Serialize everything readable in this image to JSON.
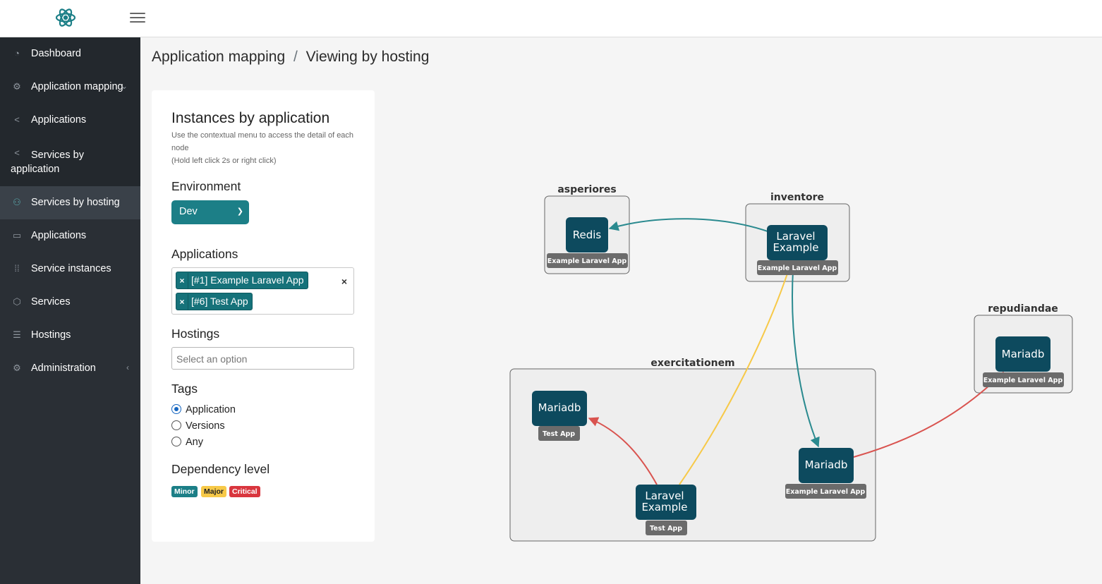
{
  "sidebar": {
    "items": [
      {
        "label": "Dashboard",
        "icon": "speedometer-icon"
      },
      {
        "label": "Application mapping",
        "icon": "gear-icon",
        "caret": "⌄"
      },
      {
        "label": "Applications",
        "icon": "share-icon"
      },
      {
        "label": "Services by",
        "label2": "application",
        "icon": "share-icon"
      },
      {
        "label": "Services by hosting",
        "icon": "hosting-tree-icon"
      },
      {
        "label": "Applications",
        "icon": "window-icon"
      },
      {
        "label": "Service instances",
        "icon": "grid-dots-icon"
      },
      {
        "label": "Services",
        "icon": "box-icon"
      },
      {
        "label": "Hostings",
        "icon": "list-icon"
      },
      {
        "label": "Administration",
        "icon": "gear-icon",
        "caret": "‹"
      }
    ]
  },
  "breadcrumb": {
    "parent": "Application mapping",
    "separator": "/",
    "current": "Viewing by hosting"
  },
  "panel": {
    "title": "Instances by application",
    "hint_line1": "Use the contextual menu to access the detail of each node",
    "hint_line2": "(Hold left click 2s or right click)",
    "environment_label": "Environment",
    "environment_value": "Dev",
    "applications_label": "Applications",
    "applications_selected": [
      "[#1] Example Laravel App",
      "[#6] Test App"
    ],
    "chip_remove": "×",
    "clear_all": "×",
    "hostings_label": "Hostings",
    "hostings_placeholder": "Select an option",
    "tags_label": "Tags",
    "tags_options": [
      "Application",
      "Versions",
      "Any"
    ],
    "tags_selected": "Application",
    "dependency_label": "Dependency level",
    "dependency_levels": [
      {
        "label": "Minor",
        "color": "#1c7f87"
      },
      {
        "label": "Major",
        "color": "#f7c948"
      },
      {
        "label": "Critical",
        "color": "#d9363e"
      }
    ]
  },
  "graph": {
    "hostings": [
      "asperiores",
      "inventore",
      "repudiandae",
      "exercitationem"
    ],
    "nodes": [
      {
        "label": "Redis",
        "tag": "Example Laravel App",
        "host": "asperiores"
      },
      {
        "label": "Laravel Example",
        "tag": "Example Laravel App",
        "host": "inventore"
      },
      {
        "label": "Mariadb",
        "tag": "Example Laravel App",
        "host": "repudiandae"
      },
      {
        "label": "Mariadb",
        "tag": "Test App",
        "host": "exercitationem"
      },
      {
        "label": "Laravel Example",
        "tag": "Test App",
        "host": "exercitationem"
      },
      {
        "label": "Mariadb",
        "tag": "Example Laravel App",
        "host": "exercitationem"
      }
    ],
    "edges": [
      {
        "from": "Laravel Example (inventore)",
        "to": "Redis",
        "level": "Minor"
      },
      {
        "from": "Laravel Example (inventore)",
        "to": "Mariadb (exercitationem)",
        "level": "Minor"
      },
      {
        "from": "Laravel Example (exercitationem)",
        "to": "Laravel Example (inventore)",
        "level": "Major"
      },
      {
        "from": "Laravel Example (exercitationem)",
        "to": "Mariadb (Test App)",
        "level": "Critical"
      },
      {
        "from": "Mariadb (exercitationem)",
        "to": "Mariadb (repudiandae)",
        "level": "Critical"
      }
    ],
    "colors": {
      "node": "#0d4a5e",
      "tag": "#6b6b6b",
      "minor": "#2a8a8f",
      "major": "#f7c948",
      "critical": "#d9534f"
    }
  }
}
